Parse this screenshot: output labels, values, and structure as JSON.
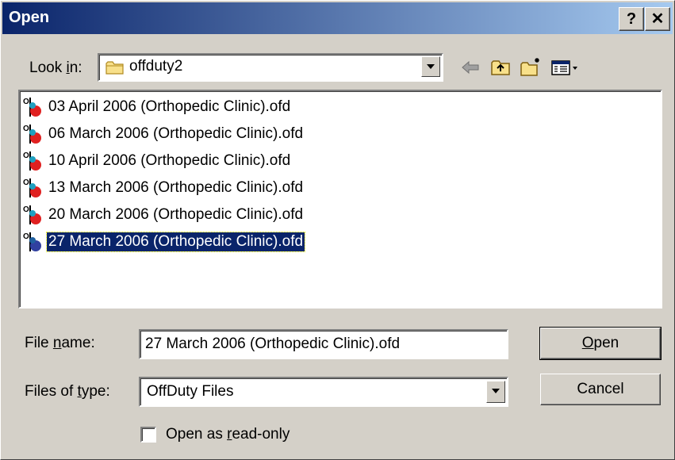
{
  "window": {
    "title": "Open",
    "help_glyph": "?",
    "close_glyph": "✕"
  },
  "lookin": {
    "label_pre": "Look ",
    "label_u": "i",
    "label_post": "n:",
    "value": "offduty2"
  },
  "toolbar": {
    "icons": [
      "back-arrow-icon",
      "up-folder-icon",
      "new-folder-icon",
      "view-menu-icon"
    ]
  },
  "files": [
    {
      "name": "03 April 2006 (Orthopedic Clinic).ofd",
      "selected": false
    },
    {
      "name": "06 March 2006 (Orthopedic Clinic).ofd",
      "selected": false
    },
    {
      "name": "10 April 2006 (Orthopedic Clinic).ofd",
      "selected": false
    },
    {
      "name": "13 March 2006 (Orthopedic Clinic).ofd",
      "selected": false
    },
    {
      "name": "20 March 2006 (Orthopedic Clinic).ofd",
      "selected": false
    },
    {
      "name": "27 March 2006 (Orthopedic Clinic).ofd",
      "selected": true
    }
  ],
  "filename": {
    "label_pre": "File ",
    "label_u": "n",
    "label_post": "ame:",
    "value": "27 March 2006 (Orthopedic Clinic).ofd"
  },
  "filetype": {
    "label_pre": "Files of ",
    "label_u": "t",
    "label_post": "ype:",
    "value": "OffDuty Files"
  },
  "readonly": {
    "label_pre": "Open as ",
    "label_u": "r",
    "label_post": "ead-only",
    "checked": false
  },
  "buttons": {
    "open_u": "O",
    "open_post": "pen",
    "cancel": "Cancel"
  },
  "colors": {
    "selection": "#0a246a",
    "titlebar_start": "#0a246a",
    "titlebar_end": "#a6caf0",
    "face": "#d4d0c8"
  }
}
